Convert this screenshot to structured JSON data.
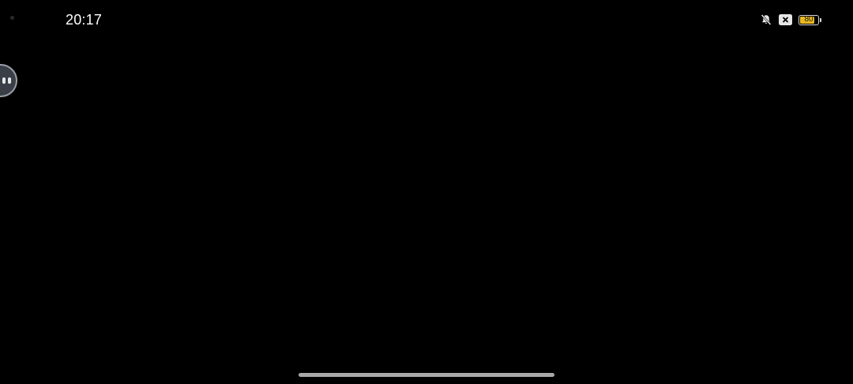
{
  "status_bar": {
    "time": "20:17",
    "icons": [
      "bell-off-icon",
      "close-box-icon",
      "battery-icon"
    ],
    "battery": {
      "level_label": "80",
      "level_fraction": 0.8,
      "fill_color": "#e8b820"
    }
  },
  "floating_assistant": {
    "icon": "floating-assistant-icon"
  },
  "colors": {
    "background": "#000000",
    "status_text": "#ffffff",
    "home_indicator": "#a9a9a9"
  }
}
